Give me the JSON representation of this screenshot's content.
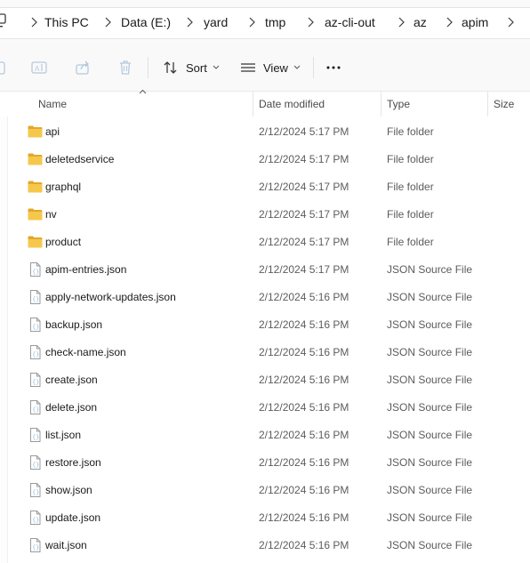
{
  "breadcrumb": [
    "This PC",
    "Data (E:)",
    "yard",
    "tmp",
    "az-cli-out",
    "az",
    "apim"
  ],
  "toolbar": {
    "sort_label": "Sort",
    "view_label": "View",
    "more_label": "···"
  },
  "columns": {
    "name": "Name",
    "date": "Date modified",
    "type": "Type",
    "size": "Size"
  },
  "rows": [
    {
      "name": "api",
      "date": "2/12/2024 5:17 PM",
      "type": "File folder",
      "icon": "folder-icon"
    },
    {
      "name": "deletedservice",
      "date": "2/12/2024 5:17 PM",
      "type": "File folder",
      "icon": "folder-icon"
    },
    {
      "name": "graphql",
      "date": "2/12/2024 5:17 PM",
      "type": "File folder",
      "icon": "folder-icon"
    },
    {
      "name": "nv",
      "date": "2/12/2024 5:17 PM",
      "type": "File folder",
      "icon": "folder-icon"
    },
    {
      "name": "product",
      "date": "2/12/2024 5:17 PM",
      "type": "File folder",
      "icon": "folder-icon"
    },
    {
      "name": "apim-entries.json",
      "date": "2/12/2024 5:17 PM",
      "type": "JSON Source File",
      "icon": "json-file-icon"
    },
    {
      "name": "apply-network-updates.json",
      "date": "2/12/2024 5:16 PM",
      "type": "JSON Source File",
      "icon": "json-file-icon"
    },
    {
      "name": "backup.json",
      "date": "2/12/2024 5:16 PM",
      "type": "JSON Source File",
      "icon": "json-file-icon"
    },
    {
      "name": "check-name.json",
      "date": "2/12/2024 5:16 PM",
      "type": "JSON Source File",
      "icon": "json-file-icon"
    },
    {
      "name": "create.json",
      "date": "2/12/2024 5:16 PM",
      "type": "JSON Source File",
      "icon": "json-file-icon"
    },
    {
      "name": "delete.json",
      "date": "2/12/2024 5:16 PM",
      "type": "JSON Source File",
      "icon": "json-file-icon"
    },
    {
      "name": "list.json",
      "date": "2/12/2024 5:16 PM",
      "type": "JSON Source File",
      "icon": "json-file-icon"
    },
    {
      "name": "restore.json",
      "date": "2/12/2024 5:16 PM",
      "type": "JSON Source File",
      "icon": "json-file-icon"
    },
    {
      "name": "show.json",
      "date": "2/12/2024 5:16 PM",
      "type": "JSON Source File",
      "icon": "json-file-icon"
    },
    {
      "name": "update.json",
      "date": "2/12/2024 5:16 PM",
      "type": "JSON Source File",
      "icon": "json-file-icon"
    },
    {
      "name": "wait.json",
      "date": "2/12/2024 5:16 PM",
      "type": "JSON Source File",
      "icon": "json-file-icon"
    }
  ],
  "colors": {
    "folder": "#f5c84c",
    "folder_dark": "#e2a72a",
    "icon_blue": "#8fb4d9",
    "text": "#1a1a1a",
    "muted": "#5c5c5c"
  }
}
